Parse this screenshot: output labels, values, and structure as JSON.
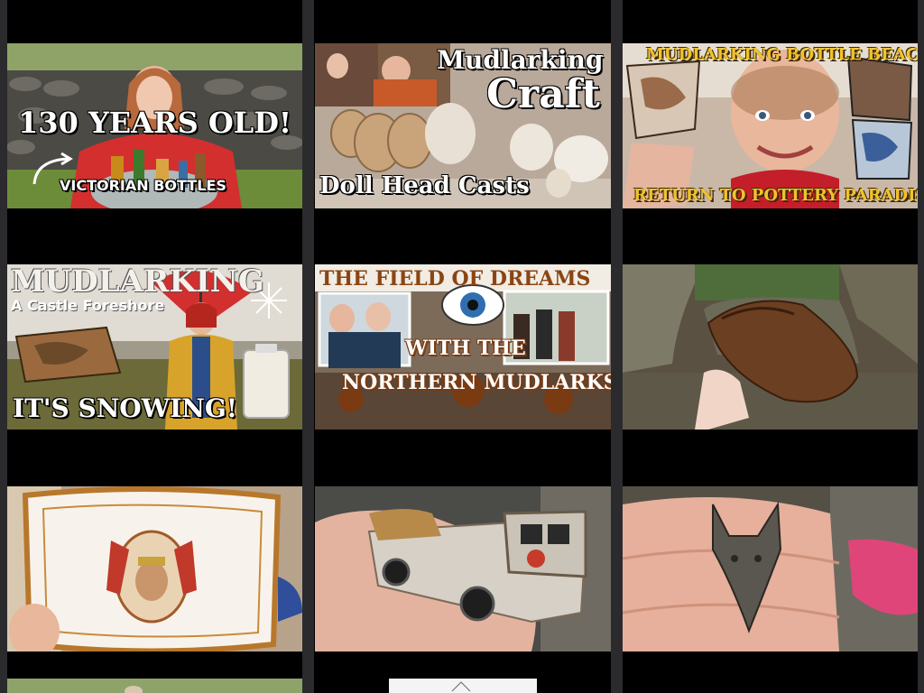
{
  "grid": {
    "videos": [
      {
        "id": "v1",
        "captions": {
          "main": "130 YEARS OLD!",
          "sub": "VICTORIAN BOTTLES"
        }
      },
      {
        "id": "v2",
        "captions": {
          "title_top": "Mudlarking",
          "title_big": "Craft",
          "sub": "Doll Head Casts"
        }
      },
      {
        "id": "v3",
        "captions": {
          "top": "MUDLARKING BOTTLE BEACH",
          "bottom": "RETURN TO POTTERY PARADISE"
        }
      },
      {
        "id": "v4",
        "captions": {
          "title": "MUDLARKING",
          "sub": "A Castle Foreshore",
          "bottom": "IT'S SNOWING!"
        }
      },
      {
        "id": "v5",
        "captions": {
          "top": "THE FIELD OF DREAMS",
          "mid": "WITH THE",
          "bottom": "NORTHERN MUDLARKS"
        }
      },
      {
        "id": "v6",
        "captions": {}
      },
      {
        "id": "v7",
        "captions": {}
      },
      {
        "id": "v8",
        "captions": {}
      },
      {
        "id": "v9",
        "captions": {}
      }
    ]
  },
  "colors": {
    "divider": "#2b2b2d",
    "background": "#000000",
    "gold_text": "#f2c22e",
    "rust": "#8b4513"
  }
}
